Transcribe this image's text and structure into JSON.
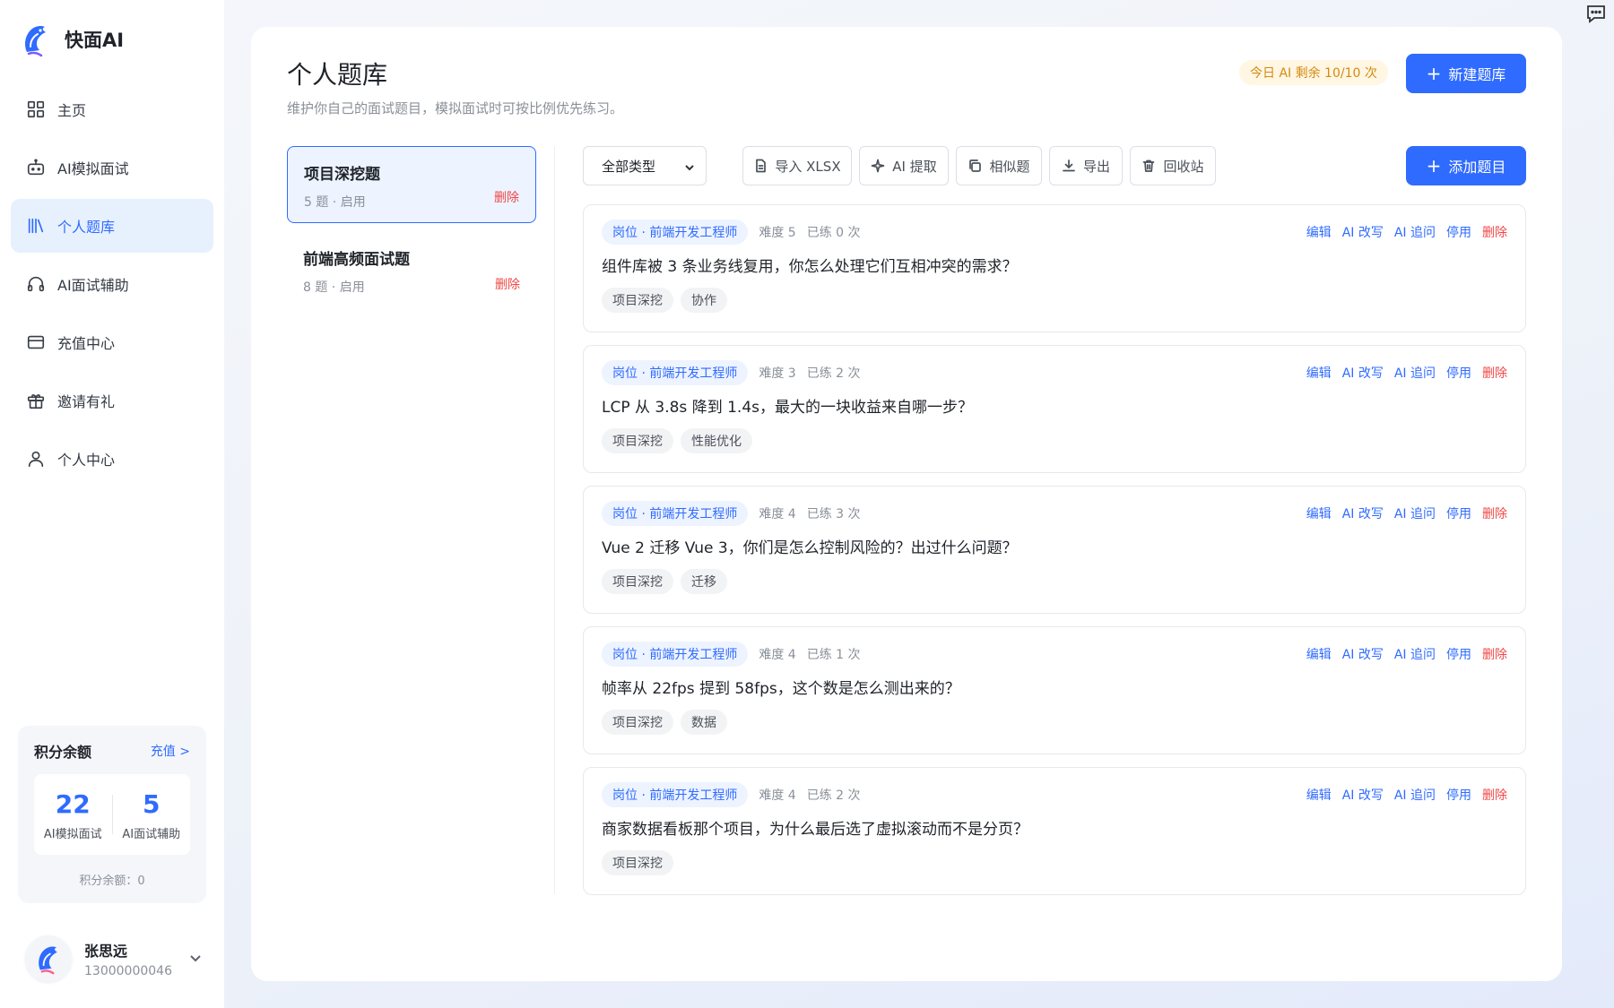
{
  "brand": {
    "name": "快面AI"
  },
  "sidebar": {
    "items": [
      {
        "label": "主页",
        "icon": "grid-icon"
      },
      {
        "label": "AI模拟面试",
        "icon": "robot-icon"
      },
      {
        "label": "个人题库",
        "icon": "library-icon",
        "active": true
      },
      {
        "label": "AI面试辅助",
        "icon": "headphones-icon"
      },
      {
        "label": "充值中心",
        "icon": "credit-card-icon"
      },
      {
        "label": "邀请有礼",
        "icon": "gift-icon"
      },
      {
        "label": "个人中心",
        "icon": "user-icon"
      }
    ]
  },
  "credits": {
    "title": "积分余额",
    "recharge_link": "充值 >",
    "stats": [
      {
        "value": "22",
        "label": "AI模拟面试"
      },
      {
        "value": "5",
        "label": "AI面试辅助"
      }
    ],
    "footer": "积分余额：0"
  },
  "user": {
    "name": "张思远",
    "phone": "13000000046"
  },
  "page": {
    "title": "个人题库",
    "subtitle": "维护你自己的面试题目，模拟面试时可按比例优先练习。",
    "quota_badge": "今日 AI 剩余 10/10 次",
    "new_bank_button": "新建题库"
  },
  "banks": [
    {
      "name": "项目深挖题",
      "meta": "5 题 · 启用",
      "delete": "删除",
      "active": true
    },
    {
      "name": "前端高频面试题",
      "meta": "8 题 · 启用",
      "delete": "删除",
      "active": false
    }
  ],
  "toolbar": {
    "type_select": "全部类型",
    "import_button": "导入 XLSX",
    "ai_extract_button": "AI 提取",
    "similar_button": "相似题",
    "export_button": "导出",
    "recycle_button": "回收站",
    "add_question_button": "添加题目"
  },
  "question_actions": [
    "编辑",
    "AI 改写",
    "AI 追问",
    "停用",
    "删除"
  ],
  "questions": [
    {
      "role": "岗位 · 前端开发工程师",
      "difficulty": "难度 5",
      "practiced": "已练 0 次",
      "text": "组件库被 3 条业务线复用，你怎么处理它们互相冲突的需求？",
      "tags": [
        "项目深挖",
        "协作"
      ]
    },
    {
      "role": "岗位 · 前端开发工程师",
      "difficulty": "难度 3",
      "practiced": "已练 2 次",
      "text": "LCP 从 3.8s 降到 1.4s，最大的一块收益来自哪一步？",
      "tags": [
        "项目深挖",
        "性能优化"
      ]
    },
    {
      "role": "岗位 · 前端开发工程师",
      "difficulty": "难度 4",
      "practiced": "已练 3 次",
      "text": "Vue 2 迁移 Vue 3，你们是怎么控制风险的？出过什么问题？",
      "tags": [
        "项目深挖",
        "迁移"
      ]
    },
    {
      "role": "岗位 · 前端开发工程师",
      "difficulty": "难度 4",
      "practiced": "已练 1 次",
      "text": "帧率从 22fps 提到 58fps，这个数是怎么测出来的？",
      "tags": [
        "项目深挖",
        "数据"
      ]
    },
    {
      "role": "岗位 · 前端开发工程师",
      "difficulty": "难度 4",
      "practiced": "已练 2 次",
      "text": "商家数据看板那个项目，为什么最后选了虚拟滚动而不是分页？",
      "tags": [
        "项目深挖"
      ]
    }
  ],
  "colors": {
    "accent": "#2f6bff",
    "danger": "#f04747",
    "warning": "#d58a10"
  }
}
